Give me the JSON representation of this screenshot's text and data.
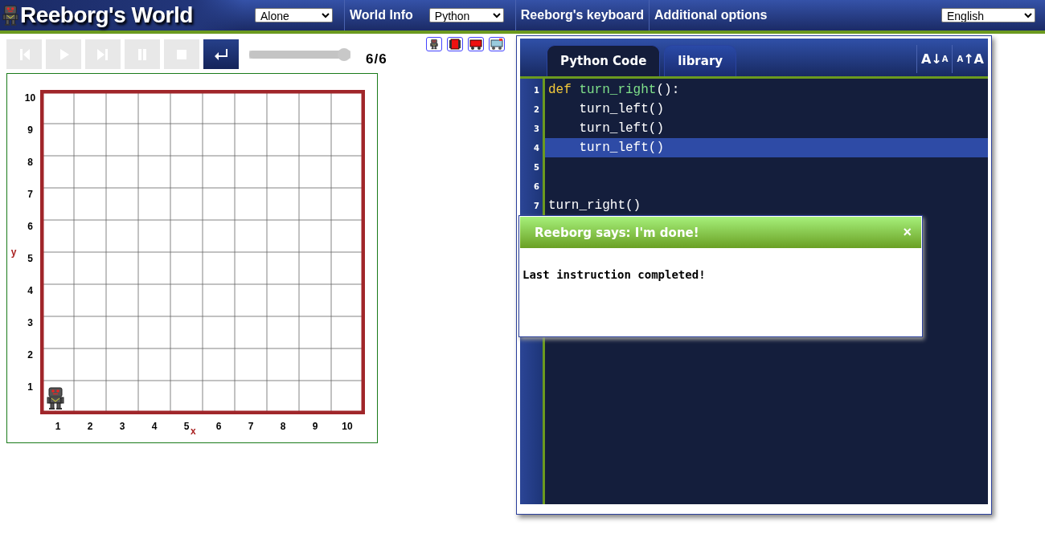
{
  "header": {
    "title": "Reeborg's World",
    "menus": [
      {
        "kind": "select",
        "value": "Alone"
      },
      {
        "kind": "link",
        "label": "World Info"
      },
      {
        "kind": "select",
        "value": "Python"
      },
      {
        "kind": "link",
        "label": "Reeborg's keyboard"
      },
      {
        "kind": "link",
        "label": "Additional options"
      }
    ],
    "language": "English"
  },
  "controls": {
    "buttons": [
      {
        "disabled": true
      },
      {
        "disabled": true
      },
      {
        "disabled": true
      },
      {
        "disabled": true
      },
      {
        "disabled": true
      },
      {
        "disabled": false
      }
    ],
    "speed": {
      "level": 1
    },
    "step": "6/6"
  },
  "world": {
    "y_label": "y",
    "x_label": "x",
    "y_ticks": [
      "10",
      "9",
      "8",
      "7",
      "6",
      "5",
      "4",
      "3",
      "2",
      "1"
    ],
    "x_ticks": [
      "1",
      "2",
      "3",
      "4",
      "5",
      "6",
      "7",
      "8",
      "9",
      "10"
    ]
  },
  "editor": {
    "tabs": [
      {
        "label": "Python Code",
        "selected": true
      },
      {
        "label": "library",
        "selected": false
      }
    ],
    "font_buttons": [
      {
        "kind": "decrease",
        "parts": [
          "A",
          "↓",
          "A"
        ]
      },
      {
        "kind": "increase",
        "parts": [
          "A",
          "↑",
          "A"
        ]
      }
    ],
    "lines": [
      {
        "number": "1",
        "selected": false,
        "tokens": [
          {
            "kind": "keyword",
            "text": "def"
          },
          {
            "kind": "function",
            "text": "turn_right"
          },
          {
            "kind": "plain",
            "text": "():"
          }
        ]
      },
      {
        "number": "2",
        "selected": false,
        "tokens": [
          {
            "kind": "plain",
            "text": "    turn_left()"
          }
        ]
      },
      {
        "number": "3",
        "selected": false,
        "tokens": [
          {
            "kind": "plain",
            "text": "    turn_left()"
          }
        ]
      },
      {
        "number": "4",
        "selected": true,
        "tokens": [
          {
            "kind": "plain",
            "text": "    turn_left()"
          }
        ]
      },
      {
        "number": "5",
        "selected": false
      },
      {
        "number": "6",
        "selected": false
      },
      {
        "number": "7",
        "selected": false,
        "tokens": [
          {
            "kind": "plain",
            "text": "turn_right()"
          }
        ]
      }
    ]
  },
  "dialog": {
    "title": "Reeborg says: I'm done!",
    "close": "×",
    "message": "Last instruction completed!"
  }
}
